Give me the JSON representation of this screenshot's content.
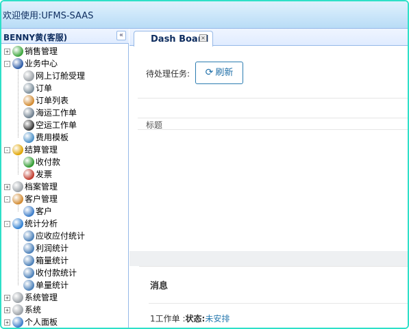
{
  "app": {
    "title": "欢迎使用:UFMS-SAAS"
  },
  "sidebar": {
    "title": "BENNY黄(客服)",
    "collapse_glyph": "«",
    "items": [
      {
        "label": "销售管理",
        "level": 0,
        "toggle": "+",
        "icon": "sales-icon",
        "color": "#3aa53a"
      },
      {
        "label": "业务中心",
        "level": 0,
        "toggle": "-",
        "icon": "ship-icon",
        "color": "#2b5aa6"
      },
      {
        "label": "网上订舱受理",
        "level": 1,
        "icon": "gear-icon",
        "color": "#9aa0a6"
      },
      {
        "label": "订单",
        "level": 1,
        "icon": "order-icon",
        "color": "#7a8c99"
      },
      {
        "label": "订单列表",
        "level": 1,
        "icon": "users-icon",
        "color": "#d1892f"
      },
      {
        "label": "海运工作单",
        "level": 1,
        "icon": "clipboard-icon",
        "color": "#6b7c8c"
      },
      {
        "label": "空运工作单",
        "level": 1,
        "icon": "card-icon",
        "color": "#333333"
      },
      {
        "label": "费用模板",
        "level": 1,
        "icon": "template-icon",
        "color": "#4a90c8"
      },
      {
        "label": "结算管理",
        "level": 0,
        "toggle": "-",
        "icon": "settlement-icon",
        "color": "#e0a400"
      },
      {
        "label": "收付款",
        "level": 1,
        "icon": "dollar-icon",
        "color": "#2e9a2e"
      },
      {
        "label": "发票",
        "level": 1,
        "icon": "invoice-icon",
        "color": "#c0392b"
      },
      {
        "label": "档案管理",
        "level": 0,
        "toggle": "+",
        "icon": "archive-icon",
        "color": "#9aa0a6"
      },
      {
        "label": "客户管理",
        "level": 0,
        "toggle": "-",
        "icon": "customer-mgmt-icon",
        "color": "#d1892f"
      },
      {
        "label": "客户",
        "level": 1,
        "icon": "customer-icon",
        "color": "#3a7bc8"
      },
      {
        "label": "统计分析",
        "level": 0,
        "toggle": "-",
        "icon": "globe-icon",
        "color": "#2f7fd1"
      },
      {
        "label": "应收应付统计",
        "level": 1,
        "icon": "chart-icon",
        "color": "#4a7fb8"
      },
      {
        "label": "利润统计",
        "level": 1,
        "icon": "chart-icon",
        "color": "#4a7fb8"
      },
      {
        "label": "箱量统计",
        "level": 1,
        "icon": "chart-icon",
        "color": "#4a7fb8"
      },
      {
        "label": "收付款统计",
        "level": 1,
        "icon": "chart-icon",
        "color": "#4a7fb8"
      },
      {
        "label": "单量统计",
        "level": 1,
        "icon": "chart-icon",
        "color": "#4a7fb8"
      },
      {
        "label": "系统管理",
        "level": 0,
        "toggle": "+",
        "icon": "gear-icon",
        "color": "#9aa0a6"
      },
      {
        "label": "系统",
        "level": 0,
        "toggle": "+",
        "icon": "gear-icon",
        "color": "#9aa0a6"
      },
      {
        "label": "个人面板",
        "level": 0,
        "toggle": "+",
        "icon": "person-icon",
        "color": "#3a7bc8"
      }
    ]
  },
  "tabs": [
    {
      "label": "Dash Board",
      "close_glyph": "×"
    }
  ],
  "dashboard": {
    "pending_label": "待处理任务:",
    "refresh_label": "刷新",
    "refresh_glyph": "⟳",
    "column_title": "标题"
  },
  "messages": {
    "title": "消息",
    "item_prefix": "1工作单 :",
    "status_key": "状态:",
    "status_value": "未安排"
  }
}
